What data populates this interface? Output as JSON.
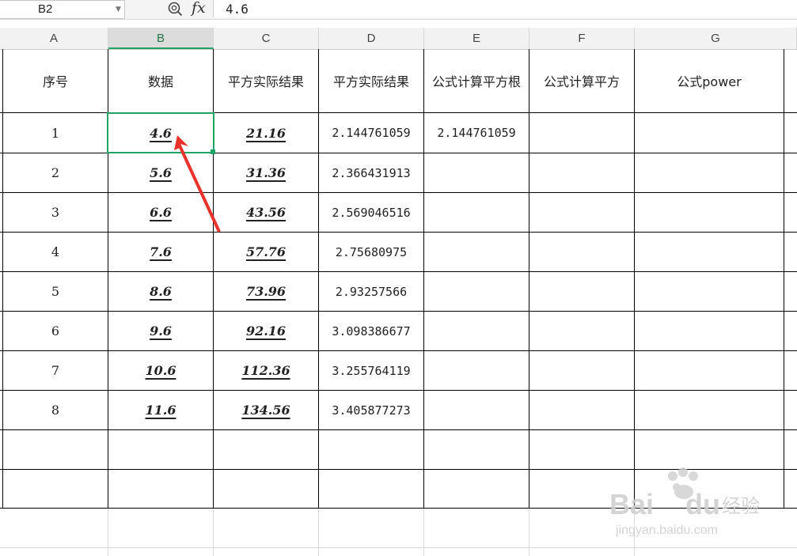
{
  "formula_bar": {
    "name_box": "B2",
    "fx_label": "fx",
    "formula": "4.6"
  },
  "columns": [
    "A",
    "B",
    "C",
    "D",
    "E",
    "F",
    "G"
  ],
  "active_column": "B",
  "headers": [
    "序号",
    "数据",
    "平方实际结果",
    "平方实际结果",
    "公式计算平方根",
    "公式计算平方",
    "公式power"
  ],
  "rows": [
    {
      "seq": "1",
      "data": "4.6",
      "square": "21.16",
      "sqrt": "2.144761059",
      "formula_sqrt": "2.144761059"
    },
    {
      "seq": "2",
      "data": "5.6",
      "square": "31.36",
      "sqrt": "2.366431913",
      "formula_sqrt": ""
    },
    {
      "seq": "3",
      "data": "6.6",
      "square": "43.56",
      "sqrt": "2.569046516",
      "formula_sqrt": ""
    },
    {
      "seq": "4",
      "data": "7.6",
      "square": "57.76",
      "sqrt": "2.75680975",
      "formula_sqrt": ""
    },
    {
      "seq": "5",
      "data": "8.6",
      "square": "73.96",
      "sqrt": "2.93257566",
      "formula_sqrt": ""
    },
    {
      "seq": "6",
      "data": "9.6",
      "square": "92.16",
      "sqrt": "3.098386677",
      "formula_sqrt": ""
    },
    {
      "seq": "7",
      "data": "10.6",
      "square": "112.36",
      "sqrt": "3.255764119",
      "formula_sqrt": ""
    },
    {
      "seq": "8",
      "data": "11.6",
      "square": "134.56",
      "sqrt": "3.405877273",
      "formula_sqrt": ""
    }
  ],
  "watermark": {
    "brand": "Baidu",
    "brand_cn": "经验",
    "url": "jingyan.baidu.com"
  },
  "colors": {
    "accent": "#21a366",
    "arrow": "#e8322b"
  }
}
